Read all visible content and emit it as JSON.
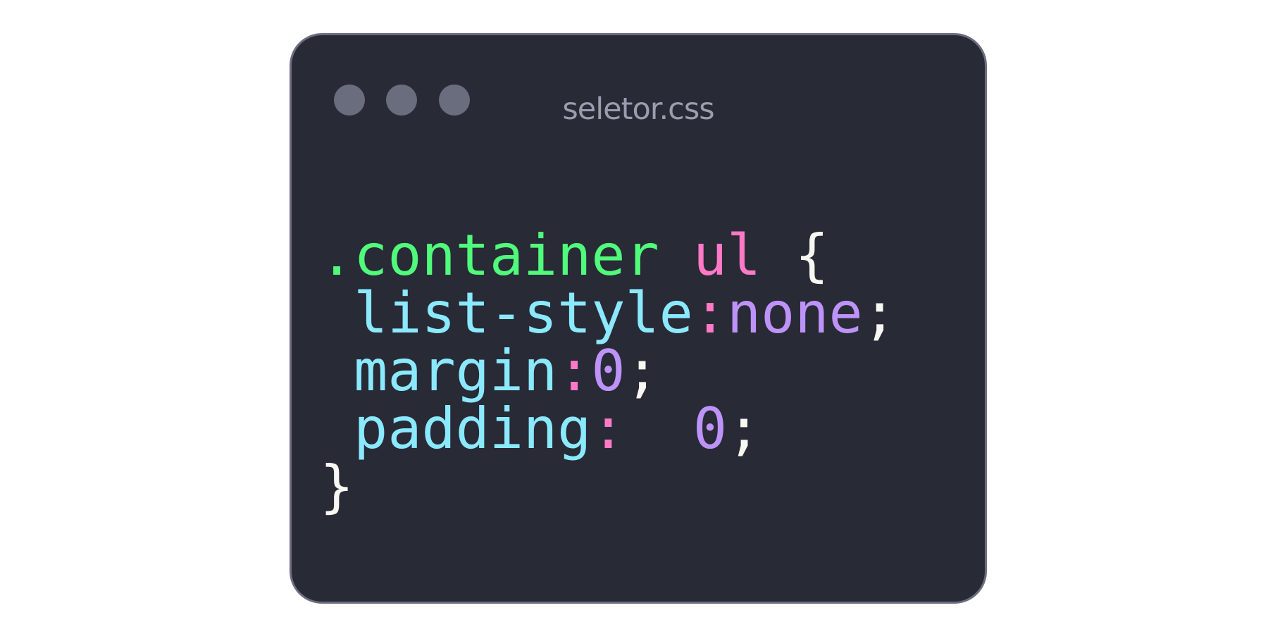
{
  "window": {
    "title": "seletor.css",
    "background_color": "#282a36",
    "border_color": "#6b6e80",
    "traffic_light_color": "#6a6d7d"
  },
  "code": {
    "selector": ".container",
    "tag": "ul",
    "open_brace": "{",
    "declarations": [
      {
        "property": "list-style",
        "colon": ":",
        "value": "none",
        "semicolon": ";"
      },
      {
        "property": "margin",
        "colon": ":",
        "value": "0",
        "semicolon": ";"
      },
      {
        "property": "padding",
        "colon": ": ",
        "value": "0",
        "semicolon": ";"
      }
    ],
    "close_brace": "}"
  },
  "colors": {
    "selector": "#50fa7b",
    "tag": "#ff79c6",
    "property": "#8be9fd",
    "colon": "#ff79c6",
    "value": "#bd93f9",
    "punctuation": "#f8f8f2"
  }
}
